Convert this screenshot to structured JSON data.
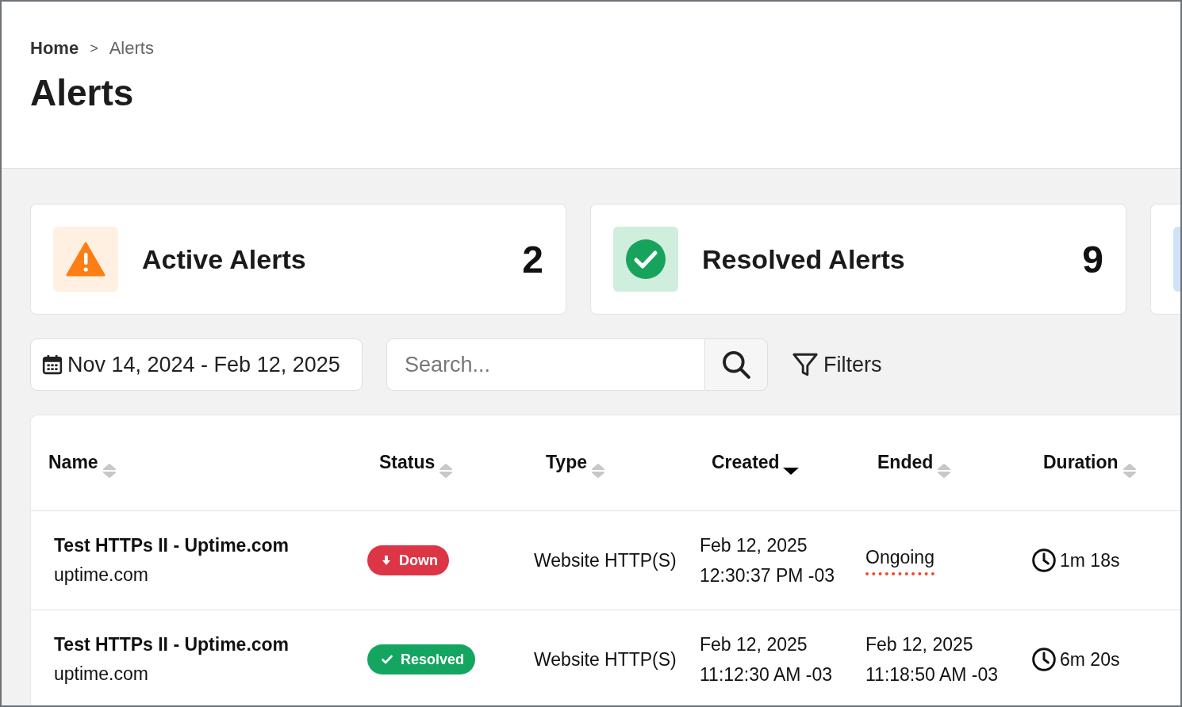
{
  "breadcrumb": [
    {
      "label": "Home",
      "current": false
    },
    {
      "label": "Alerts",
      "current": true
    }
  ],
  "breadcrumb_separator": ">",
  "page_title": "Alerts",
  "summary_cards": [
    {
      "kind": "active",
      "label": "Active Alerts",
      "count": "2"
    },
    {
      "kind": "resolved",
      "label": "Resolved Alerts",
      "count": "9"
    },
    {
      "kind": "other"
    }
  ],
  "date_range": {
    "value": "Nov 14, 2024 - Feb 12, 2025"
  },
  "search": {
    "placeholder": "Search..."
  },
  "filters_button": "Filters",
  "table": {
    "columns": [
      {
        "label": "Name",
        "sorted": false
      },
      {
        "label": "Status",
        "sorted": false
      },
      {
        "label": "Type",
        "sorted": false
      },
      {
        "label": "Created",
        "sorted": true
      },
      {
        "label": "Ended",
        "sorted": false
      },
      {
        "label": "Duration",
        "sorted": false
      }
    ],
    "rows": [
      {
        "name": "Test HTTPs II - Uptime.com",
        "host": "uptime.com",
        "status": {
          "kind": "down",
          "label": "Down"
        },
        "type": "Website HTTP(S)",
        "created": [
          "Feb 12, 2025",
          "12:30:37 PM -03"
        ],
        "ended": {
          "kind": "ongoing",
          "lines": [
            "Ongoing"
          ]
        },
        "duration": "1m 18s"
      },
      {
        "name": "Test HTTPs II - Uptime.com",
        "host": "uptime.com",
        "status": {
          "kind": "resolved",
          "label": "Resolved"
        },
        "type": "Website HTTP(S)",
        "created": [
          "Feb 12, 2025",
          "11:12:30 AM -03"
        ],
        "ended": {
          "kind": "date",
          "lines": [
            "Feb 12, 2025",
            "11:18:50 AM -03"
          ]
        },
        "duration": "6m 20s"
      }
    ]
  }
}
